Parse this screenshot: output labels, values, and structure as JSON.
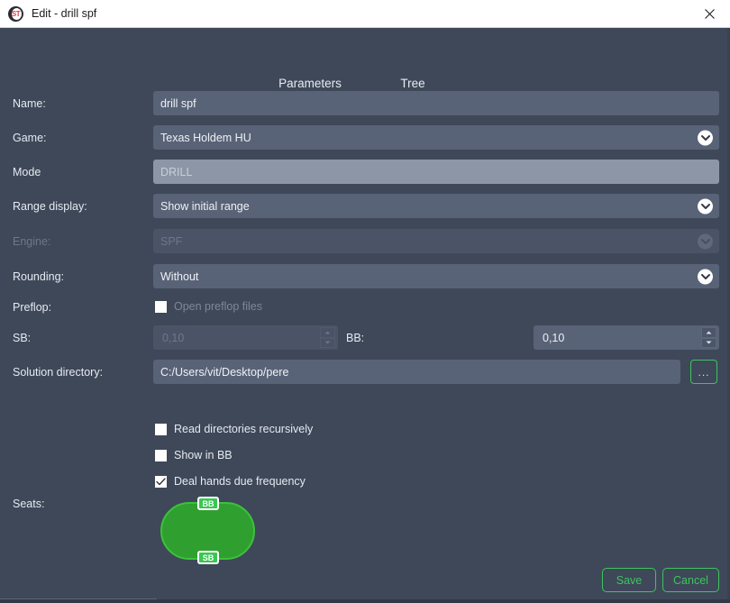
{
  "window": {
    "title": "Edit - drill spf",
    "logo_icon": "solver-logo-icon",
    "logo_text": "ST",
    "close_icon": "close-icon"
  },
  "tabs": [
    {
      "label": "Parameters",
      "active": true,
      "underline_color": "#e8414f"
    },
    {
      "label": "Tree",
      "active": false,
      "underline_color": "#f2f4f7"
    }
  ],
  "form": {
    "name": {
      "label": "Name:",
      "value": "drill spf"
    },
    "game": {
      "label": "Game:",
      "value": "Texas Holdem HU",
      "arrow_icon": "chevron-down-icon"
    },
    "mode": {
      "label": "Mode",
      "value": "DRILL"
    },
    "range_display": {
      "label": "Range display:",
      "value": "Show initial range",
      "arrow_icon": "chevron-down-icon"
    },
    "engine": {
      "label": "Engine:",
      "value": "SPF",
      "arrow_icon": "chevron-down-icon"
    },
    "rounding": {
      "label": "Rounding:",
      "value": "Without",
      "arrow_icon": "chevron-down-icon"
    },
    "preflop": {
      "label": "Preflop:",
      "checkbox_label": "Open preflop files",
      "checked": false
    },
    "sb": {
      "label": "SB:",
      "value": "0,10"
    },
    "bb": {
      "label": "BB:",
      "value": "0,10"
    },
    "solution_directory": {
      "label": "Solution directory:",
      "value": "C:/Users/vit/Desktop/pere",
      "browse_label": "..."
    },
    "options": [
      {
        "label": "Read directories recursively",
        "checked": false
      },
      {
        "label": "Show in BB",
        "checked": false
      },
      {
        "label": "Deal hands due frequency",
        "checked": true
      }
    ],
    "seats": {
      "label": "Seats:",
      "badges": [
        "BB",
        "SB"
      ],
      "table_color": "#2fa02f",
      "badge_color": "#3bc653"
    }
  },
  "footer": {
    "save_label": "Save",
    "cancel_label": "Cancel",
    "accent_color": "#3ec45e"
  }
}
